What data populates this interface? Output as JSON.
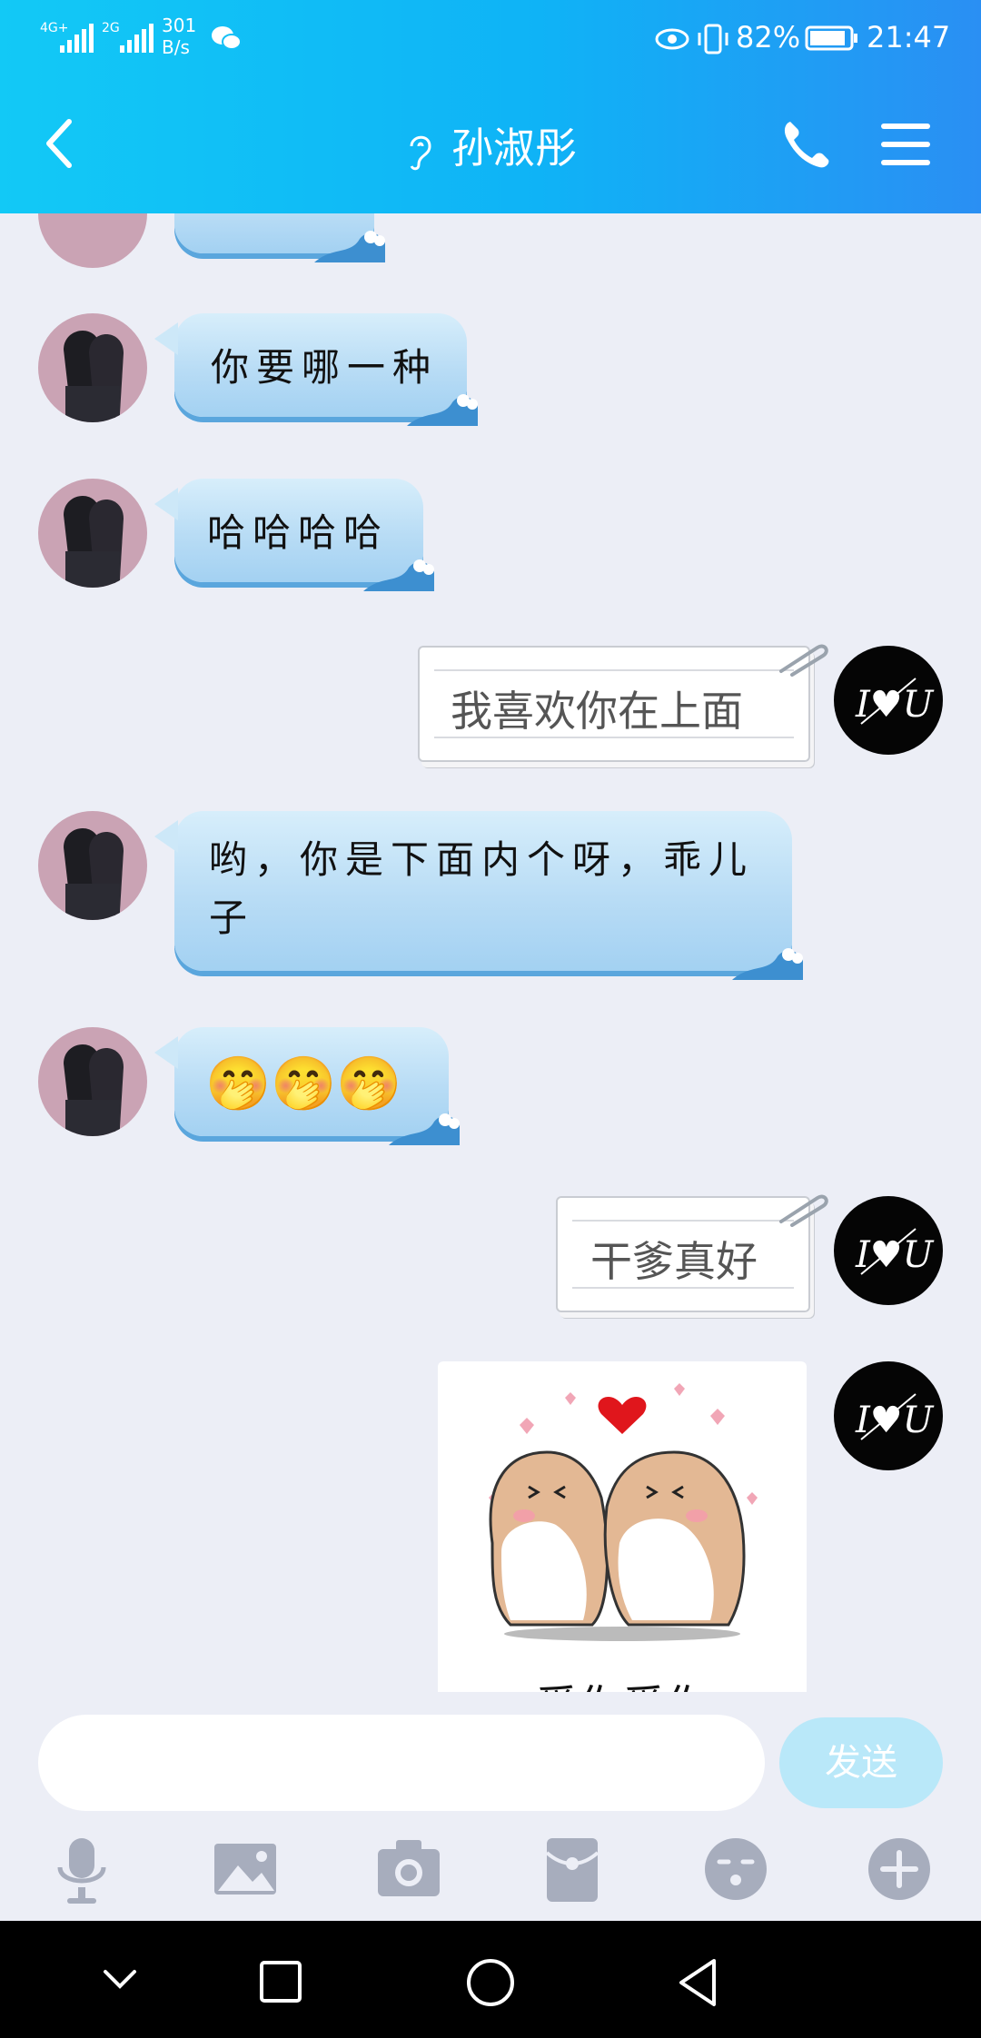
{
  "status_bar": {
    "net_speed_value": "301",
    "net_speed_unit": "B/s",
    "battery": "82%",
    "time": "21:47",
    "sig1": "4G+",
    "sig2": "2G"
  },
  "header": {
    "contact_name": "孙淑彤"
  },
  "messages": [
    {
      "side": "left",
      "type": "text",
      "text": "你要哪一种"
    },
    {
      "side": "left",
      "type": "text",
      "text": "哈哈哈哈"
    },
    {
      "side": "right",
      "type": "text",
      "text": "我喜欢你在上面"
    },
    {
      "side": "left",
      "type": "text",
      "text": "哟，你是下面内个呀，乖儿子"
    },
    {
      "side": "left",
      "type": "emoji",
      "text": "🤭🤭🤭"
    },
    {
      "side": "right",
      "type": "text",
      "text": "干爹真好"
    },
    {
      "side": "right",
      "type": "sticker",
      "caption": "爱你爱你"
    }
  ],
  "input": {
    "placeholder": "",
    "send_label": "发送"
  },
  "toolbar": [
    "microphone-icon",
    "image-icon",
    "camera-icon",
    "red-packet-icon",
    "emoji-icon",
    "plus-icon"
  ],
  "colors": {
    "header": "#12c9f6",
    "bubble": "#b8dcf5",
    "background": "#eceef6",
    "send": "#b9e8f9"
  }
}
